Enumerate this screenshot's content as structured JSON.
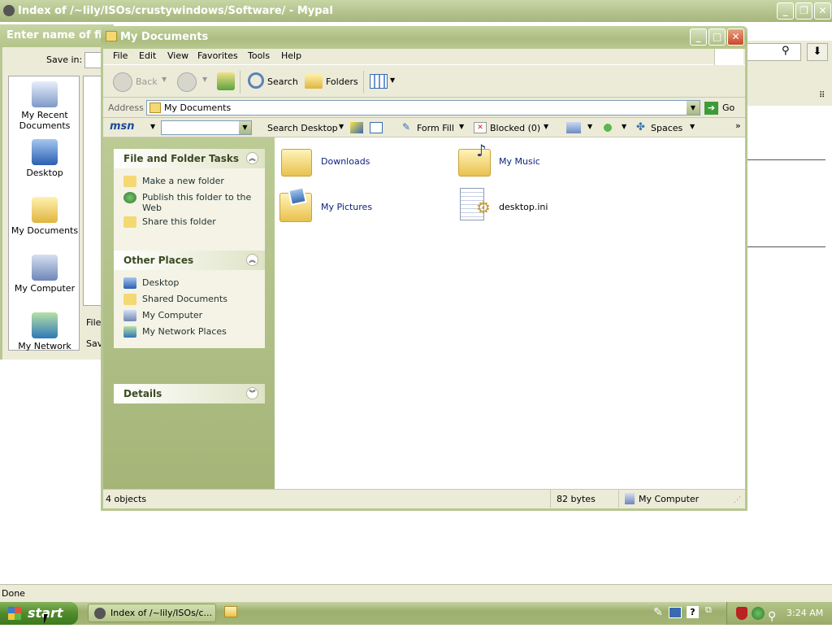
{
  "browser": {
    "title": "Index of /~lily/ISOs/crustywindows/Software/ - Mypal",
    "status": "Done"
  },
  "save_dialog": {
    "title": "Enter name of file",
    "save_in_label": "Save in:",
    "places": [
      "My Recent Documents",
      "Desktop",
      "My Documents",
      "My Computer",
      "My Network"
    ],
    "file_label": "File",
    "save_label": "Sav"
  },
  "explorer": {
    "title": "My Documents",
    "menu": [
      "File",
      "Edit",
      "View",
      "Favorites",
      "Tools",
      "Help"
    ],
    "toolbar": {
      "back": "Back",
      "search": "Search",
      "folders": "Folders"
    },
    "address": {
      "label": "Address",
      "value": "My Documents",
      "go": "Go"
    },
    "msn": {
      "logo": "msn",
      "search_desktop": "Search Desktop",
      "form_fill": "Form Fill",
      "blocked": "Blocked (0)",
      "spaces": "Spaces"
    },
    "tasks": {
      "file_folder": {
        "title": "File and Folder Tasks",
        "items": [
          "Make a new folder",
          "Publish this folder to the Web",
          "Share this folder"
        ]
      },
      "other_places": {
        "title": "Other Places",
        "items": [
          "Desktop",
          "Shared Documents",
          "My Computer",
          "My Network Places"
        ]
      },
      "details": {
        "title": "Details"
      }
    },
    "files": [
      {
        "name": "Downloads",
        "icon": "folder-icon"
      },
      {
        "name": "My Music",
        "icon": "music-folder-icon"
      },
      {
        "name": "My Pictures",
        "icon": "pictures-folder-icon"
      },
      {
        "name": "desktop.ini",
        "icon": "settings-file-icon"
      }
    ],
    "status": {
      "objects": "4 objects",
      "size": "82 bytes",
      "location": "My Computer"
    }
  },
  "taskbar": {
    "start": "start",
    "task_label": "Index of /~lily/ISOs/c...",
    "clock": "3:24 AM"
  },
  "colors": {
    "title_green": "#abbd81",
    "start_green": "#4f8a2b",
    "link_blue": "#0b1f7a"
  }
}
